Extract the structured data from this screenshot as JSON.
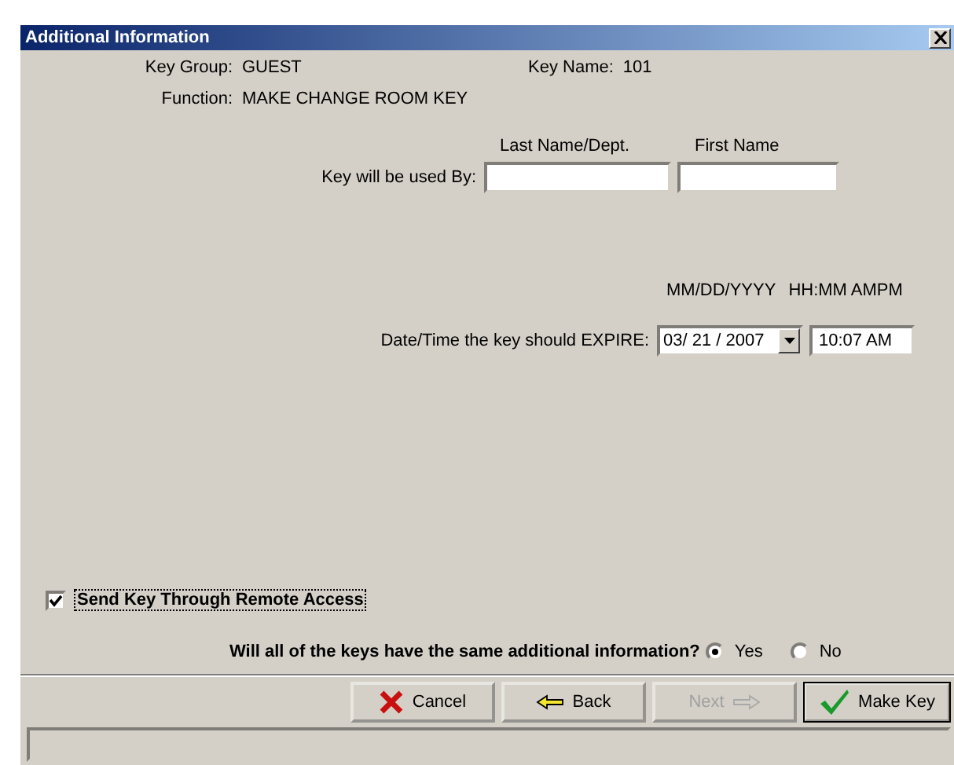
{
  "window": {
    "title": "Additional Information"
  },
  "info": [
    {
      "label": "Key Group:",
      "value": "GUEST"
    },
    {
      "label": "Key Name:",
      "value": "101"
    },
    {
      "label": "Function:",
      "value": "MAKE CHANGE ROOM KEY"
    }
  ],
  "used_by": {
    "label": "Key will be used By:",
    "fields": [
      {
        "heading": "Last Name/Dept."
      },
      {
        "heading": "First Name"
      }
    ]
  },
  "expire": {
    "format_date": "MM/DD/YYYY",
    "format_time": "HH:MM AMPM",
    "label": "Date/Time the key should EXPIRE:",
    "date": "03/ 21 / 2007",
    "time": "10:07 AM"
  },
  "remote_access": {
    "label": "Send Key Through Remote Access",
    "checked": true
  },
  "same_info": {
    "question": "Will all of the keys have the same additional information?",
    "options": [
      {
        "label": "Yes",
        "selected": true
      },
      {
        "label": "No",
        "selected": false
      }
    ]
  },
  "buttons": [
    {
      "kind": "cancel",
      "label": "Cancel",
      "disabled": false,
      "default": false
    },
    {
      "kind": "back",
      "label": "Back",
      "disabled": false,
      "default": false
    },
    {
      "kind": "next",
      "label": "Next",
      "disabled": true,
      "default": false
    },
    {
      "kind": "make",
      "label": "Make Key",
      "disabled": false,
      "default": true
    }
  ]
}
